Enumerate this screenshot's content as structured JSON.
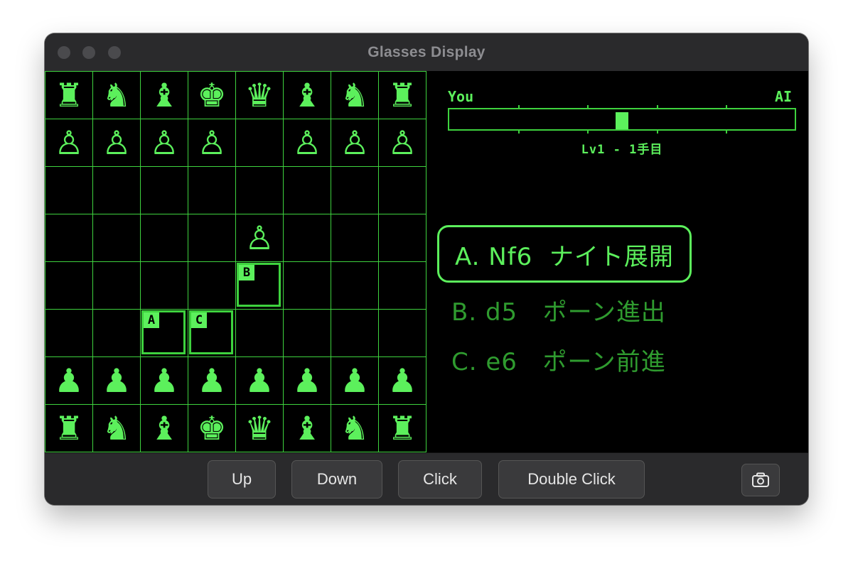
{
  "window": {
    "title": "Glasses Display"
  },
  "board": {
    "rows": [
      [
        "♜",
        "♞",
        "♝",
        "♚",
        "♛",
        "♝",
        "♞",
        "♜"
      ],
      [
        "♙",
        "♙",
        "♙",
        "♙",
        "",
        "♙",
        "♙",
        "♙"
      ],
      [
        "",
        "",
        "",
        "",
        "",
        "",
        "",
        ""
      ],
      [
        "",
        "",
        "",
        "",
        "♙",
        "",
        "",
        ""
      ],
      [
        "",
        "",
        "",
        "",
        "",
        "",
        "",
        ""
      ],
      [
        "",
        "",
        "",
        "",
        "",
        "",
        "",
        ""
      ],
      [
        "♟",
        "♟",
        "♟",
        "♟",
        "♟",
        "♟",
        "♟",
        "♟"
      ],
      [
        "♜",
        "♞",
        "♝",
        "♚",
        "♛",
        "♝",
        "♞",
        "♜"
      ]
    ],
    "hints": [
      {
        "label": "A",
        "row": 5,
        "col": 3
      },
      {
        "label": "C",
        "row": 5,
        "col": 4
      },
      {
        "label": "B",
        "row": 4,
        "col": 5
      }
    ]
  },
  "meter": {
    "left_label": "You",
    "right_label": "AI",
    "position": 0.5,
    "level_text": "Lv1  -  1手目"
  },
  "options": [
    {
      "text": "A. Nf6  ナイト展開",
      "selected": true
    },
    {
      "text": "B. d5   ポーン進出",
      "selected": false
    },
    {
      "text": "C. e6   ポーン前進",
      "selected": false
    }
  ],
  "toolbar": {
    "up_label": "Up",
    "down_label": "Down",
    "click_label": "Click",
    "double_click_label": "Double Click",
    "screenshot_icon": "camera-icon"
  },
  "colors": {
    "accent": "#5cf05c",
    "dim": "#2f9b2f",
    "grid": "#3ed23e"
  }
}
